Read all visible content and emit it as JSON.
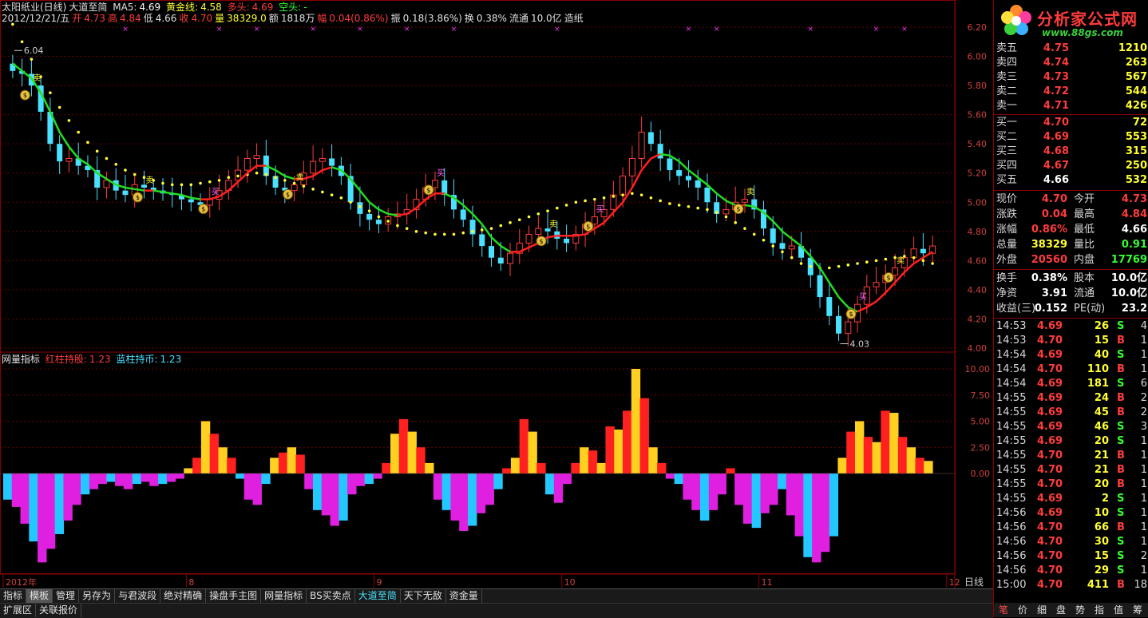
{
  "header": {
    "title": "太阳纸业(日线)",
    "indicator_name": "大道至简",
    "ma5_label": "MA5:",
    "ma5": "4.69",
    "golden_label": "黄金线:",
    "golden": "4.58",
    "bull_label": "多头:",
    "bull": "4.69",
    "bear_label": "空头:",
    "bear": "-",
    "date": "2012/12/21/五",
    "open_label": "开",
    "open": "4.73",
    "high_label": "高",
    "high": "4.84",
    "low_label": "低",
    "low": "4.66",
    "close_label": "收",
    "close": "4.70",
    "vol_label": "量",
    "vol": "38329.0",
    "amount_label": "额",
    "amount": "1818万",
    "range_label": "幅",
    "range": "0.04(0.86%)",
    "amp_label": "振",
    "amp": "0.18(3.86%)",
    "turnover_label": "换",
    "turnover": "0.38%",
    "float_label": "流通",
    "float": "10.0亿",
    "industry": "造纸"
  },
  "sub_header": {
    "name": "网量指标",
    "red_label": "红柱持股:",
    "red": "1.23",
    "blue_label": "蓝柱持币:",
    "blue": "1.23"
  },
  "price_axis": [
    "6.20",
    "6.00",
    "5.80",
    "5.60",
    "5.40",
    "5.20",
    "5.00",
    "4.80",
    "4.60",
    "4.40",
    "4.20",
    "4.00"
  ],
  "sub_axis": [
    "10.00",
    "7.50",
    "5.00",
    "2.50",
    "0.00"
  ],
  "date_axis": [
    "2012年",
    "8",
    "9",
    "10",
    "11",
    "12"
  ],
  "annotations": {
    "high_mark": "6.04",
    "low_mark": "4.03",
    "buy": "买",
    "sell": "卖",
    "dollar": "$"
  },
  "scale_label": "日线",
  "logo": {
    "title": "分析家公式网",
    "url": "www.88gs.com"
  },
  "order_book": {
    "asks": [
      {
        "label": "卖五",
        "price": "4.75",
        "vol": "1210"
      },
      {
        "label": "卖四",
        "price": "4.74",
        "vol": "263"
      },
      {
        "label": "卖三",
        "price": "4.73",
        "vol": "567"
      },
      {
        "label": "卖二",
        "price": "4.72",
        "vol": "544"
      },
      {
        "label": "卖一",
        "price": "4.71",
        "vol": "426"
      }
    ],
    "bids": [
      {
        "label": "买一",
        "price": "4.70",
        "vol": "72"
      },
      {
        "label": "买二",
        "price": "4.69",
        "vol": "553"
      },
      {
        "label": "买三",
        "price": "4.68",
        "vol": "315"
      },
      {
        "label": "买四",
        "price": "4.67",
        "vol": "250"
      },
      {
        "label": "买五",
        "price": "4.66",
        "vol": "532"
      }
    ]
  },
  "stats": [
    {
      "l1": "现价",
      "v1": "4.70",
      "c1": "#ff3c3c",
      "l2": "今开",
      "v2": "4.73",
      "c2": "#ff3c3c"
    },
    {
      "l1": "涨跌",
      "v1": "0.04",
      "c1": "#ff3c3c",
      "l2": "最高",
      "v2": "4.84",
      "c2": "#ff3c3c"
    },
    {
      "l1": "涨幅",
      "v1": "0.86%",
      "c1": "#ff3c3c",
      "l2": "最低",
      "v2": "4.66",
      "c2": "#ffffff"
    },
    {
      "l1": "总量",
      "v1": "38329",
      "c1": "#ffff33",
      "l2": "量比",
      "v2": "0.91",
      "c2": "#33ff33"
    },
    {
      "l1": "外盘",
      "v1": "20560",
      "c1": "#ff3c3c",
      "l2": "内盘",
      "v2": "17769",
      "c2": "#33ff33"
    },
    {
      "l1": "换手",
      "v1": "0.38%",
      "c1": "#ffffff",
      "l2": "股本",
      "v2": "10.0亿",
      "c2": "#ffffff"
    },
    {
      "l1": "净资",
      "v1": "3.91",
      "c1": "#ffffff",
      "l2": "流通",
      "v2": "10.0亿",
      "c2": "#ffffff"
    },
    {
      "l1": "收益(三)",
      "v1": "0.152",
      "c1": "#ffffff",
      "l2": "PE(动)",
      "v2": "23.2",
      "c2": "#ffffff"
    }
  ],
  "ticks": [
    {
      "t": "14:53",
      "p": "4.69",
      "pc": "#ff3c3c",
      "v": "26",
      "d": "S",
      "dc": "#33ff33",
      "n": "4"
    },
    {
      "t": "14:53",
      "p": "4.70",
      "pc": "#ff3c3c",
      "v": "15",
      "d": "B",
      "dc": "#ff3c3c",
      "n": "1"
    },
    {
      "t": "14:54",
      "p": "4.69",
      "pc": "#ff3c3c",
      "v": "40",
      "d": "S",
      "dc": "#33ff33",
      "n": "1"
    },
    {
      "t": "14:54",
      "p": "4.70",
      "pc": "#ff3c3c",
      "v": "110",
      "d": "B",
      "dc": "#ff3c3c",
      "n": "1"
    },
    {
      "t": "14:54",
      "p": "4.69",
      "pc": "#ff3c3c",
      "v": "181",
      "d": "S",
      "dc": "#33ff33",
      "n": "6"
    },
    {
      "t": "14:55",
      "p": "4.69",
      "pc": "#ff3c3c",
      "v": "24",
      "d": "B",
      "dc": "#ff3c3c",
      "n": "2"
    },
    {
      "t": "14:55",
      "p": "4.69",
      "pc": "#ff3c3c",
      "v": "45",
      "d": "B",
      "dc": "#ff3c3c",
      "n": "2"
    },
    {
      "t": "14:55",
      "p": "4.69",
      "pc": "#ff3c3c",
      "v": "46",
      "d": "S",
      "dc": "#33ff33",
      "n": "3"
    },
    {
      "t": "14:55",
      "p": "4.69",
      "pc": "#ff3c3c",
      "v": "20",
      "d": "S",
      "dc": "#33ff33",
      "n": "1"
    },
    {
      "t": "14:55",
      "p": "4.70",
      "pc": "#ff3c3c",
      "v": "21",
      "d": "B",
      "dc": "#ff3c3c",
      "n": "1"
    },
    {
      "t": "14:55",
      "p": "4.70",
      "pc": "#ff3c3c",
      "v": "21",
      "d": "B",
      "dc": "#ff3c3c",
      "n": "1"
    },
    {
      "t": "14:55",
      "p": "4.70",
      "pc": "#ff3c3c",
      "v": "20",
      "d": "B",
      "dc": "#ff3c3c",
      "n": "1"
    },
    {
      "t": "14:55",
      "p": "4.69",
      "pc": "#ff3c3c",
      "v": "2",
      "d": "S",
      "dc": "#33ff33",
      "n": "1"
    },
    {
      "t": "14:56",
      "p": "4.69",
      "pc": "#ff3c3c",
      "v": "10",
      "d": "S",
      "dc": "#33ff33",
      "n": "1"
    },
    {
      "t": "14:56",
      "p": "4.70",
      "pc": "#ff3c3c",
      "v": "66",
      "d": "B",
      "dc": "#ff3c3c",
      "n": "1"
    },
    {
      "t": "14:56",
      "p": "4.70",
      "pc": "#ff3c3c",
      "v": "30",
      "d": "S",
      "dc": "#33ff33",
      "n": "1"
    },
    {
      "t": "14:56",
      "p": "4.70",
      "pc": "#ff3c3c",
      "v": "15",
      "d": "S",
      "dc": "#33ff33",
      "n": "2"
    },
    {
      "t": "14:56",
      "p": "4.70",
      "pc": "#ff3c3c",
      "v": "29",
      "d": "S",
      "dc": "#33ff33",
      "n": "1"
    },
    {
      "t": "15:00",
      "p": "4.70",
      "pc": "#ff3c3c",
      "v": "411",
      "d": "B",
      "dc": "#ff3c3c",
      "n": "18"
    }
  ],
  "bottom_tabs": [
    "指标",
    "模板",
    "管理",
    "另存为",
    "与君波段",
    "绝对精确",
    "操盘手主图",
    "网量指标",
    "BS买卖点",
    "大道至简",
    "天下无敌",
    "资金量"
  ],
  "bottom_tabs2": [
    "扩展区",
    "关联报价"
  ],
  "panel_tabs": [
    "笔",
    "价",
    "细",
    "盘",
    "势",
    "指",
    "值",
    "筹"
  ],
  "zoom": [
    "+",
    "-",
    "○"
  ],
  "chart_data": {
    "type": "candlestick",
    "x": [
      "2012年",
      "8",
      "9",
      "10",
      "11",
      "12"
    ],
    "ylim": [
      4.0,
      6.2
    ],
    "sub_ylim": [
      -10.0,
      10.0
    ],
    "close": [
      5.9,
      5.88,
      5.8,
      5.62,
      5.4,
      5.28,
      5.3,
      5.25,
      5.22,
      5.1,
      5.15,
      5.08,
      5.05,
      5.12,
      5.1,
      5.08,
      5.06,
      5.05,
      5.02,
      5.0,
      4.98,
      5.02,
      5.08,
      5.15,
      5.22,
      5.3,
      5.32,
      5.18,
      5.1,
      5.08,
      5.12,
      5.2,
      5.28,
      5.3,
      5.25,
      5.18,
      5.0,
      4.92,
      4.88,
      4.85,
      4.9,
      4.92,
      4.95,
      5.02,
      5.1,
      5.15,
      5.05,
      4.95,
      4.88,
      4.78,
      4.7,
      4.62,
      4.58,
      4.65,
      4.72,
      4.78,
      4.82,
      4.8,
      4.75,
      4.72,
      4.78,
      4.85,
      4.9,
      4.95,
      5.05,
      5.18,
      5.3,
      5.48,
      5.4,
      5.3,
      5.22,
      5.18,
      5.15,
      5.1,
      5.0,
      4.92,
      4.95,
      5.0,
      5.02,
      4.95,
      4.82,
      4.72,
      4.68,
      4.7,
      4.62,
      4.5,
      4.35,
      4.22,
      4.1,
      4.18,
      4.3,
      4.42,
      4.45,
      4.5,
      4.55,
      4.62,
      4.68,
      4.65,
      4.7
    ],
    "ma5": [
      5.95,
      5.9,
      5.85,
      5.75,
      5.62,
      5.48,
      5.38,
      5.3,
      5.26,
      5.2,
      5.16,
      5.12,
      5.1,
      5.09,
      5.08,
      5.08,
      5.07,
      5.06,
      5.05,
      5.03,
      5.02,
      5.02,
      5.04,
      5.08,
      5.14,
      5.2,
      5.25,
      5.25,
      5.22,
      5.18,
      5.16,
      5.16,
      5.18,
      5.22,
      5.24,
      5.22,
      5.16,
      5.08,
      5.0,
      4.95,
      4.92,
      4.91,
      4.92,
      4.96,
      5.02,
      5.06,
      5.06,
      5.03,
      4.98,
      4.92,
      4.85,
      4.76,
      4.7,
      4.66,
      4.66,
      4.69,
      4.72,
      4.76,
      4.77,
      4.77,
      4.77,
      4.78,
      4.82,
      4.86,
      4.93,
      5.0,
      5.1,
      5.22,
      5.3,
      5.33,
      5.32,
      5.28,
      5.22,
      5.17,
      5.12,
      5.06,
      5.01,
      4.98,
      4.98,
      4.97,
      4.93,
      4.87,
      4.8,
      4.75,
      4.7,
      4.63,
      4.55,
      4.45,
      4.35,
      4.28,
      4.25,
      4.28,
      4.32,
      4.38,
      4.45,
      4.52,
      4.58,
      4.62,
      4.66
    ],
    "golden": [
      6.22,
      6.1,
      5.98,
      5.86,
      5.75,
      5.65,
      5.56,
      5.48,
      5.41,
      5.35,
      5.3,
      5.26,
      5.22,
      5.19,
      5.17,
      5.15,
      5.13,
      5.12,
      5.12,
      5.12,
      5.13,
      5.14,
      5.15,
      5.17,
      5.18,
      5.19,
      5.2,
      5.19,
      5.17,
      5.15,
      5.13,
      5.11,
      5.09,
      5.07,
      5.05,
      5.03,
      5.0,
      4.97,
      4.94,
      4.9,
      4.87,
      4.84,
      4.82,
      4.8,
      4.79,
      4.78,
      4.78,
      4.78,
      4.79,
      4.8,
      4.81,
      4.82,
      4.84,
      4.86,
      4.88,
      4.9,
      4.92,
      4.94,
      4.96,
      4.98,
      5.0,
      5.01,
      5.02,
      5.03,
      5.04,
      5.05,
      5.06,
      5.05,
      5.03,
      5.01,
      4.99,
      4.98,
      4.97,
      4.96,
      4.95,
      4.93,
      4.9,
      4.86,
      4.82,
      4.78,
      4.74,
      4.7,
      4.66,
      4.62,
      4.58,
      4.56,
      4.55,
      4.55,
      4.56,
      4.57,
      4.58,
      4.59,
      4.6,
      4.61,
      4.62,
      4.63,
      4.62,
      4.6,
      4.58
    ],
    "sub_values": [
      -2.5,
      -3.2,
      -4.8,
      -6.5,
      -8.5,
      -7.2,
      -5.8,
      -4.5,
      -3.0,
      -2.0,
      -1.5,
      -1.0,
      -0.8,
      -1.2,
      -1.5,
      -1.0,
      -0.8,
      -1.2,
      -1.0,
      -0.8,
      -0.5,
      0.5,
      1.5,
      5.0,
      3.8,
      2.5,
      1.5,
      -0.5,
      -2.5,
      -3.0,
      -1.0,
      1.5,
      2.0,
      2.5,
      1.8,
      -1.5,
      -3.5,
      -4.0,
      -5.0,
      -4.5,
      -2.0,
      -1.2,
      -1.0,
      -0.5,
      1.0,
      3.8,
      5.2,
      4.0,
      2.5,
      1.0,
      -2.5,
      -3.5,
      -4.5,
      -5.5,
      -5.0,
      -3.8,
      -3.0,
      -1.5,
      0.5,
      1.5,
      5.2,
      4.0,
      1.0,
      -2.0,
      -2.8,
      -1.0,
      1.0,
      2.5,
      2.2,
      1.0,
      4.5,
      4.2,
      6.0,
      10.0,
      7.2,
      2.5,
      1.0,
      -0.5,
      -1.0,
      -2.5,
      -3.5,
      -4.5,
      -3.5,
      -2.0,
      0.5,
      -3.0,
      -4.8,
      -5.2,
      -3.8,
      -3.0,
      -1.5,
      -4.0,
      -6.0,
      -8.0,
      -8.5,
      -7.5,
      -6.0,
      1.5,
      4.0,
      5.0,
      3.5,
      3.0,
      6.0,
      5.8,
      3.5,
      2.5,
      1.5,
      1.2
    ],
    "signals": [
      {
        "type": "sell",
        "index": 2
      },
      {
        "type": "sell",
        "index": 14
      },
      {
        "type": "buy",
        "index": 21
      },
      {
        "type": "sell",
        "index": 30
      },
      {
        "type": "buy",
        "index": 45
      },
      {
        "type": "sell",
        "index": 57
      },
      {
        "type": "buy",
        "index": 62
      },
      {
        "type": "sell",
        "index": 78
      },
      {
        "type": "buy",
        "index": 90
      },
      {
        "type": "sell",
        "index": 94
      }
    ]
  }
}
